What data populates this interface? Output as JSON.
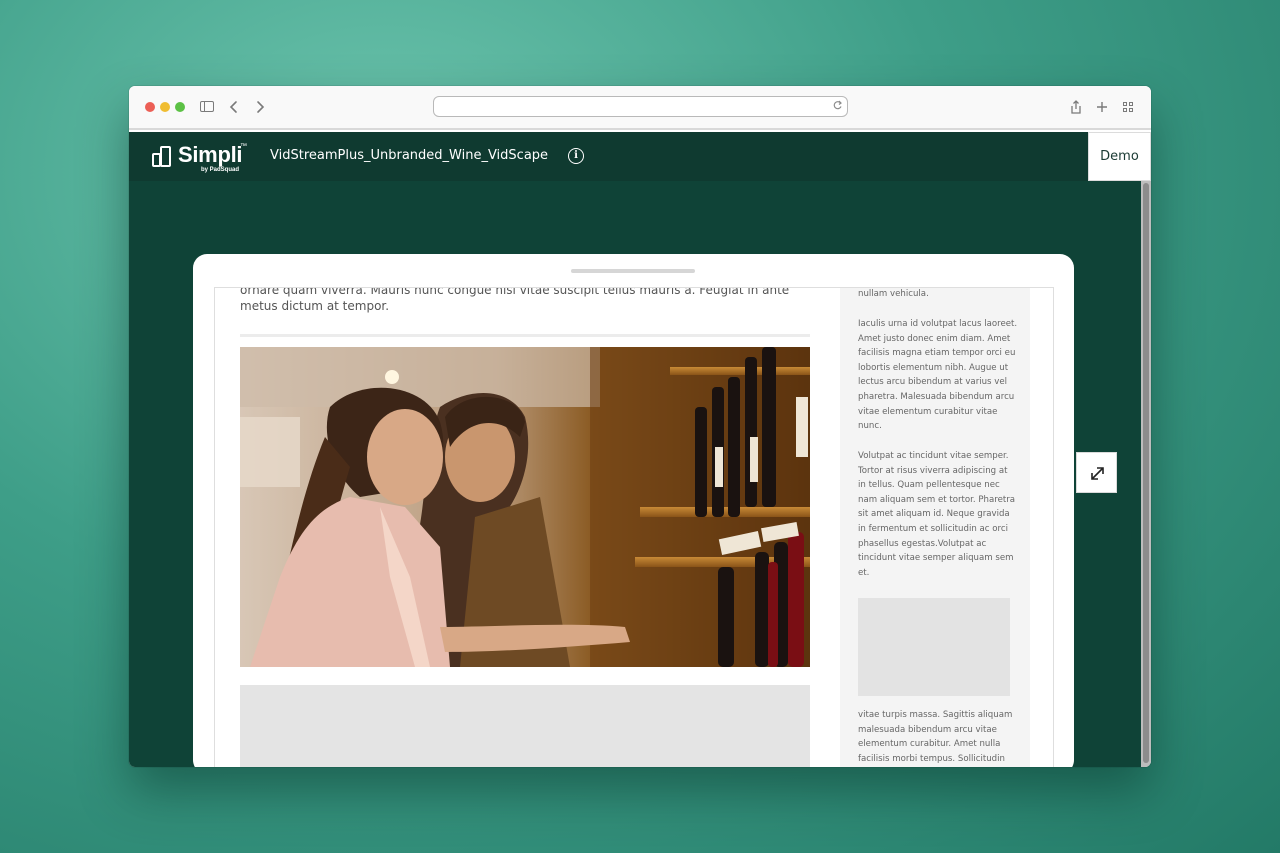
{
  "browser": {
    "url_value": "",
    "icons": [
      "sidebar-icon",
      "back-icon",
      "forward-icon",
      "reload-icon",
      "share-icon",
      "new-tab-icon",
      "tab-overview-icon"
    ]
  },
  "header": {
    "logo_text": "Simpli",
    "logo_tm": "™",
    "logo_sub": "by PadSquad",
    "ad_title": "VidStreamPlus_Unbranded_Wine_VidScape",
    "demo_label": "Demo"
  },
  "article": {
    "intro_text": "ornare quam viverra. Mauris nunc congue nisi vitae suscipit tellus mauris a. Feugiat in ante metus dictum at tempor."
  },
  "sidebar": {
    "p1": "nullam vehicula.",
    "p2": "Iaculis urna id volutpat lacus laoreet. Amet justo donec enim diam. Amet facilisis magna etiam tempor orci eu lobortis elementum nibh. Augue ut lectus arcu bibendum at varius vel pharetra. Malesuada bibendum arcu vitae elementum curabitur vitae nunc.",
    "p3": "Volutpat ac tincidunt vitae semper. Tortor at risus viverra adipiscing at in tellus. Quam pellentesque nec nam aliquam sem et tortor. Pharetra sit amet aliquam id. Neque gravida in fermentum et sollicitudin ac orci phasellus egestas.Volutpat ac tincidunt vitae semper aliquam sem et.",
    "p4": "vitae turpis massa. Sagittis aliquam malesuada bibendum arcu vitae elementum curabitur. Amet nulla facilisis morbi tempus. Sollicitudin"
  },
  "colors": {
    "background_teal": "#4aa892",
    "header_green": "#0f3a30",
    "stage_green": "#0f4337"
  }
}
